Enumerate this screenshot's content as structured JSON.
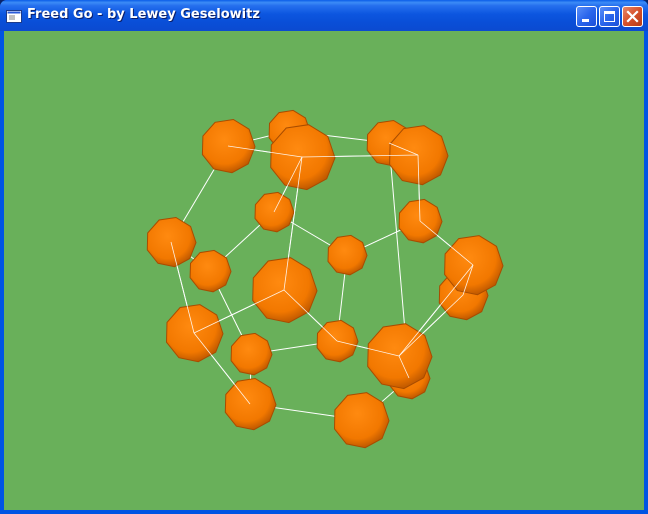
{
  "window": {
    "title": "Freed Go - by Lewey Geselowitz"
  },
  "titlebar_buttons": {
    "minimize_icon": "minimize-icon",
    "maximize_icon": "maximize-icon",
    "close_icon": "close-icon"
  },
  "scene": {
    "background_color": "#69b05a",
    "node_color": "#ff7f00",
    "edge_color": "#ffffff"
  }
}
